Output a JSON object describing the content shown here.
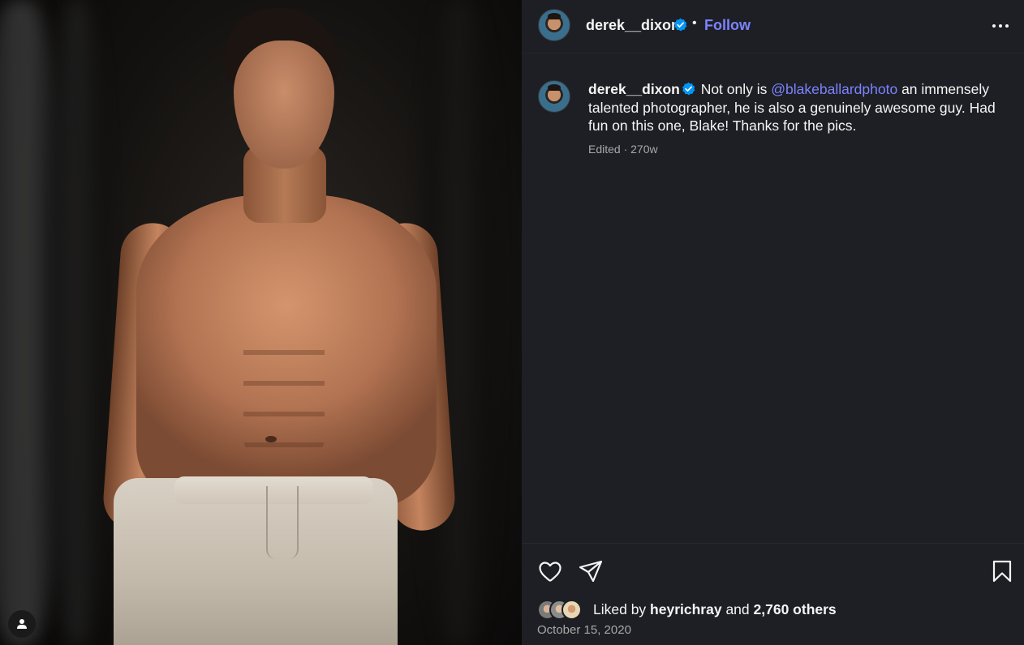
{
  "post": {
    "username": "derek__dixon",
    "verified": true,
    "follow_label": "Follow",
    "separator": "•",
    "more_icon": "more-horizontal-icon"
  },
  "caption": {
    "username": "derek__dixon",
    "text_before": " Not only is ",
    "mention": "@blakeballardphoto",
    "text_after": " an immensely talented photographer, he is also a genuinely awesome guy. Had fun on this one, Blake! Thanks for the pics.",
    "meta": "Edited · 270w"
  },
  "actions": {
    "like_icon": "heart-icon",
    "share_icon": "send-icon",
    "save_icon": "bookmark-icon"
  },
  "likes": {
    "prefix": "Liked by ",
    "liker": "heyrichray",
    "connector": " and ",
    "others": "2,760 others"
  },
  "date": "October 15, 2020",
  "colors": {
    "background_dark": "#1e1f24",
    "link_blue": "#7c83ff",
    "verified_blue": "#0095f6",
    "muted_text": "#a8a8a8"
  }
}
